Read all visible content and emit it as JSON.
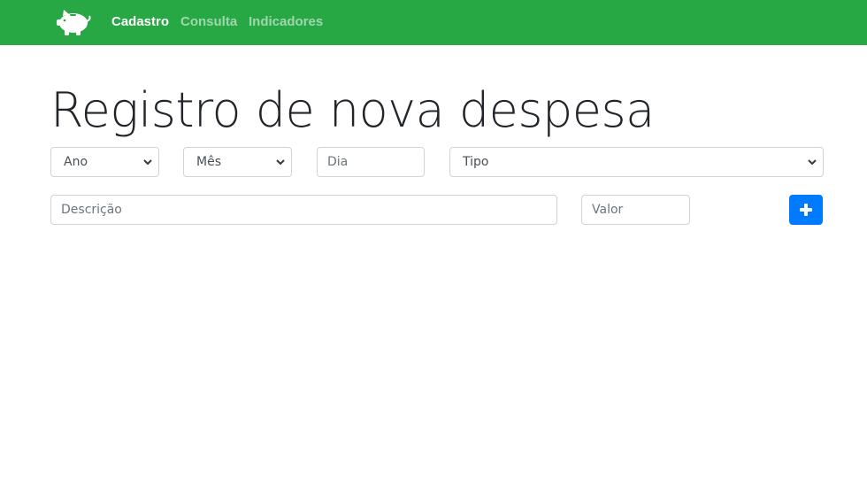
{
  "navbar": {
    "brand_icon": "piggy-bank-icon",
    "links": [
      "Cadastro",
      "Consulta",
      "Indicadores"
    ],
    "background": "#28a745"
  },
  "page": {
    "title": "Registro de nova despesa"
  },
  "form": {
    "ano": "Ano",
    "mes": "Mês",
    "dia_placeholder": "Dia",
    "tipo": "Tipo",
    "descricao_placeholder": "Descrição",
    "valor_placeholder": "Valor",
    "add_button_icon": "plus-icon",
    "add_button_color": "#007bff"
  }
}
